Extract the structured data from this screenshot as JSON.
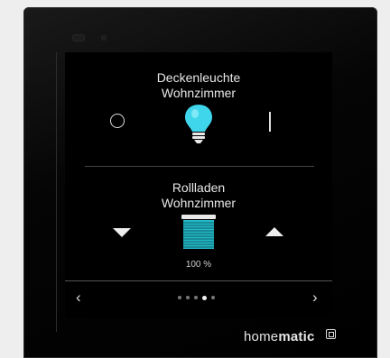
{
  "tile1": {
    "title_line1": "Deckenleuchte",
    "title_line2": "Wohnzimmer"
  },
  "tile2": {
    "title_line1": "Rollladen",
    "title_line2": "Wohnzimmer",
    "position_label": "100 %"
  },
  "navigation": {
    "prev": "‹",
    "next": "›",
    "page_count": 5,
    "active_page_index": 3
  },
  "brand": {
    "name_light": "home",
    "name_bold": "matic"
  },
  "icons": {
    "off": "power-off-icon",
    "on": "power-on-icon",
    "bulb": "lightbulb-icon",
    "down": "arrow-down-icon",
    "up": "arrow-up-icon",
    "shutter": "shutter-icon"
  },
  "colors": {
    "bulb": "#3fd6ec",
    "shutter": "#22b8c6"
  }
}
